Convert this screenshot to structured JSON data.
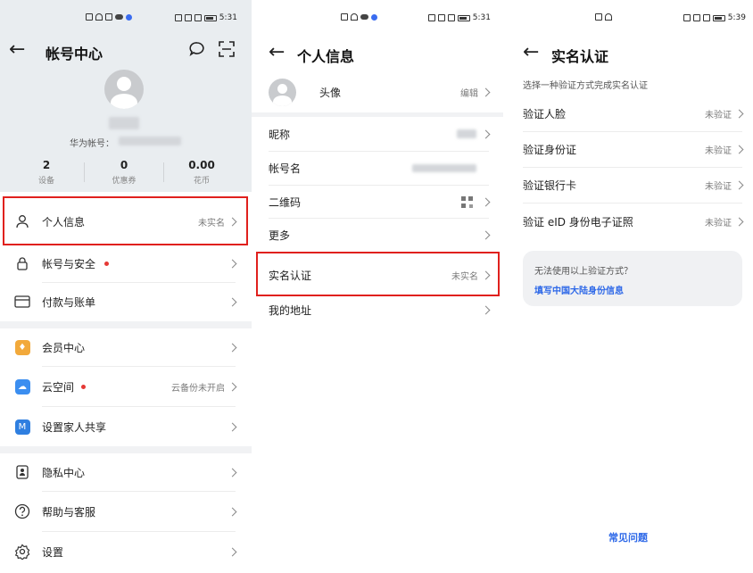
{
  "screen1": {
    "status": {
      "time": "5:31"
    },
    "header": {
      "title": "帐号中心",
      "back": "←"
    },
    "account_label": "华为帐号：",
    "stats": [
      {
        "value": "2",
        "label": "设备"
      },
      {
        "value": "0",
        "label": "优惠券"
      },
      {
        "value": "0.00",
        "label": "花币"
      }
    ],
    "menu": {
      "personal_info": {
        "label": "个人信息",
        "value": "未实名"
      },
      "account_security": {
        "label": "帐号与安全"
      },
      "payment": {
        "label": "付款与账单"
      },
      "member": {
        "label": "会员中心"
      },
      "cloud": {
        "label": "云空间",
        "value": "云备份未开启"
      },
      "family": {
        "label": "设置家人共享"
      },
      "privacy": {
        "label": "隐私中心"
      },
      "help": {
        "label": "帮助与客服"
      },
      "settings": {
        "label": "设置"
      }
    },
    "icons": [
      "back-arrow-icon",
      "chat-bubble-icon",
      "scan-icon",
      "person-icon",
      "lock-icon",
      "card-icon",
      "vip-icon",
      "cloud-icon",
      "family-icon",
      "privacy-icon",
      "help-icon",
      "settings-icon"
    ]
  },
  "screen2": {
    "status": {
      "time": "5:31"
    },
    "header": {
      "title": "个人信息",
      "back": "←"
    },
    "avatar_row": {
      "label": "头像",
      "value": "编辑"
    },
    "rows": {
      "nickname": {
        "label": "昵称"
      },
      "account_name": {
        "label": "帐号名"
      },
      "qrcode": {
        "label": "二维码"
      },
      "more": {
        "label": "更多"
      },
      "realname": {
        "label": "实名认证",
        "value": "未实名"
      },
      "address": {
        "label": "我的地址"
      }
    }
  },
  "screen3": {
    "status": {
      "time": "5:39"
    },
    "header": {
      "title": "实名认证",
      "back": "←"
    },
    "subtitle": "选择一种验证方式完成实名认证",
    "methods": [
      {
        "label": "验证人脸",
        "value": "未验证"
      },
      {
        "label": "验证身份证",
        "value": "未验证"
      },
      {
        "label": "验证银行卡",
        "value": "未验证"
      },
      {
        "label": "验证 eID 身份电子证照",
        "value": "未验证"
      }
    ],
    "card": {
      "question": "无法使用以上验证方式？",
      "link": "填写中国大陆身份信息"
    },
    "faq": "常见问题"
  },
  "colors": {
    "accent_link": "#2d68e8",
    "highlight_box": "#e0201d",
    "red_dot": "#e53935",
    "header_bg": "#e9edf0"
  }
}
